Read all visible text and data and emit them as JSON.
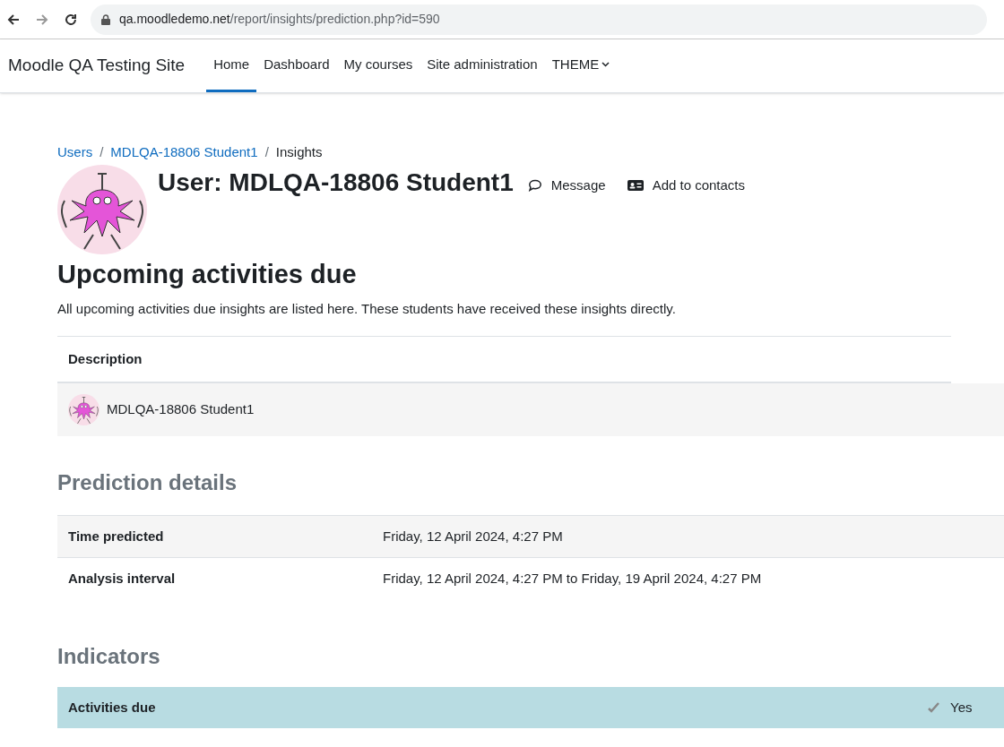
{
  "browser": {
    "url_host": "qa.moodledemo.net",
    "url_path": "/report/insights/prediction.php?id=590"
  },
  "navbar": {
    "site_name": "Moodle QA Testing Site",
    "items": [
      {
        "label": "Home",
        "selected": true,
        "kind": "link"
      },
      {
        "label": "Dashboard",
        "selected": false,
        "kind": "link"
      },
      {
        "label": "My courses",
        "selected": false,
        "kind": "link"
      },
      {
        "label": "Site administration",
        "selected": false,
        "kind": "link"
      },
      {
        "label": "THEME",
        "selected": false,
        "kind": "dropdown"
      }
    ]
  },
  "breadcrumbs": [
    {
      "label": "Users",
      "kind": "link"
    },
    {
      "separator": "/",
      "label": "MDLQA-18806 Student1",
      "kind": "link"
    },
    {
      "separator": "/",
      "label": "Insights",
      "kind": "current"
    }
  ],
  "user": {
    "title": "User: MDLQA-18806 Student1",
    "actions": [
      {
        "label": "Message",
        "kind": "message"
      },
      {
        "label": "Add to contacts",
        "kind": "contact"
      }
    ]
  },
  "insight": {
    "title": "Upcoming activities due",
    "description": "All upcoming activities due insights are listed here. These students have received these insights directly.",
    "table": {
      "columns": [
        "Description"
      ],
      "rows": [
        {
          "name": "MDLQA-18806 Student1"
        }
      ]
    }
  },
  "prediction_details": {
    "title": "Prediction details",
    "rows": [
      {
        "label": "Time predicted",
        "value": "Friday, 12 April 2024, 4:27 PM"
      },
      {
        "label": "Analysis interval",
        "value": "Friday, 12 April 2024, 4:27 PM to Friday, 19 April 2024, 4:27 PM"
      }
    ]
  },
  "indicators": {
    "title": "Indicators",
    "rows": [
      {
        "label": "Activities due",
        "value": "Yes",
        "checked": true
      }
    ]
  }
}
